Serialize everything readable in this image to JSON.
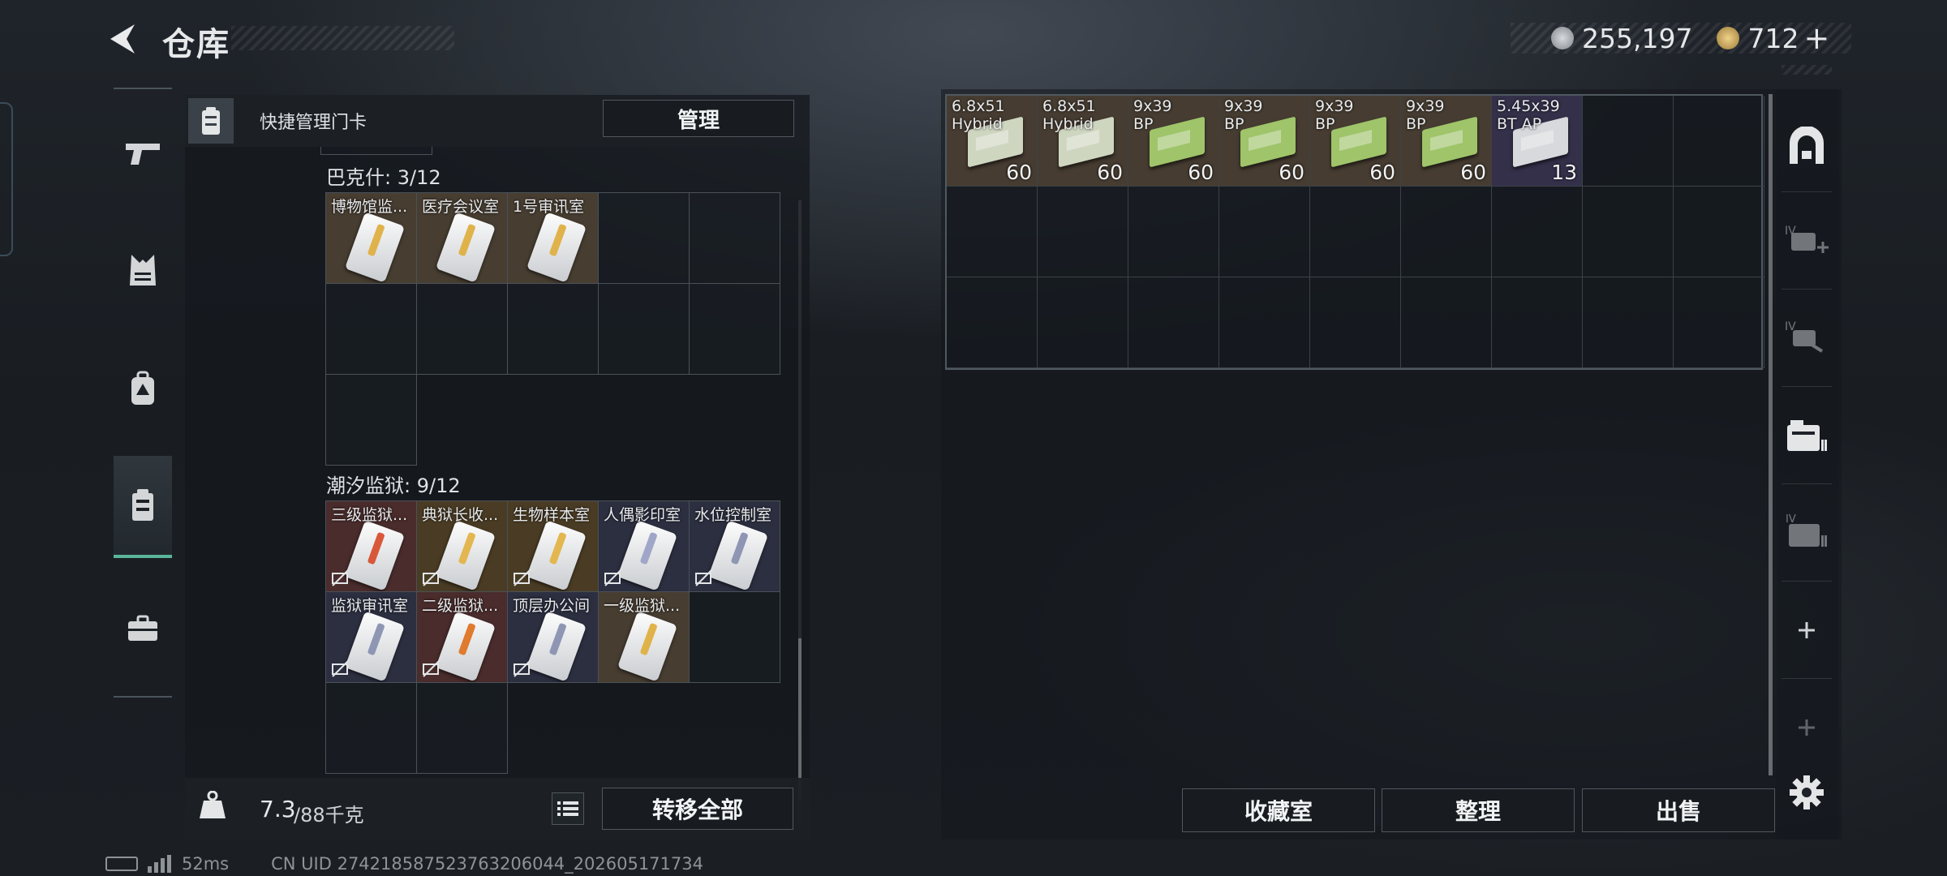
{
  "header": {
    "title": "仓库",
    "currency1": "255,197",
    "currency2": "712",
    "plus": "+"
  },
  "sidebar": {
    "items": [
      {
        "name": "weapons"
      },
      {
        "name": "armor"
      },
      {
        "name": "backpack"
      },
      {
        "name": "keycard-case",
        "active": true
      },
      {
        "name": "toolbox"
      }
    ]
  },
  "left_panel": {
    "header_label": "快捷管理门卡",
    "manage_button": "管理",
    "sections": [
      {
        "title": "巴克什: 3/12",
        "cards": [
          {
            "label": "博物馆监...",
            "tint": "#e0b24a",
            "locked": false
          },
          {
            "label": "医疗会议室",
            "tint": "#e0b24a",
            "locked": false
          },
          {
            "label": "1号审讯室",
            "tint": "#e0b24a",
            "locked": false
          }
        ]
      },
      {
        "title": "潮汐监狱: 9/12",
        "cards": [
          {
            "label": "三级监狱...",
            "tint": "#d9583a",
            "locked": true
          },
          {
            "label": "典狱长收...",
            "tint": "#e3b64f",
            "locked": true
          },
          {
            "label": "生物样本室",
            "tint": "#e3b64f",
            "locked": true
          },
          {
            "label": "人偶影印室",
            "tint": "#a0a6c8",
            "locked": true
          },
          {
            "label": "水位控制室",
            "tint": "#8e96b4",
            "locked": true
          },
          {
            "label": "监狱审讯室",
            "tint": "#8e96b4",
            "locked": true
          },
          {
            "label": "二级监狱...",
            "tint": "#e07a2e",
            "locked": true
          },
          {
            "label": "顶层办公间",
            "tint": "#8e96b4",
            "locked": true
          },
          {
            "label": "一级监狱...",
            "tint": "#e0b24a",
            "locked": false
          }
        ]
      }
    ],
    "weight_value": "7.3",
    "weight_capacity": "/88千克",
    "transfer_all_button": "转移全部"
  },
  "right_panel": {
    "items": [
      {
        "name": "6.8x51\nHybrid",
        "qty": "60",
        "color": "#cfd6c0"
      },
      {
        "name": "6.8x51\nHybrid",
        "qty": "60",
        "color": "#cfd6c0"
      },
      {
        "name": "9x39\nBP",
        "qty": "60",
        "color": "#9fc46a"
      },
      {
        "name": "9x39\nBP",
        "qty": "60",
        "color": "#9fc46a"
      },
      {
        "name": "9x39\nBP",
        "qty": "60",
        "color": "#9fc46a"
      },
      {
        "name": "9x39\nBP",
        "qty": "60",
        "color": "#9fc46a"
      },
      {
        "name": "5.45x39\nBT AP",
        "qty": "13",
        "color": "#d7d9dc"
      }
    ],
    "buttons": {
      "collection": "收藏室",
      "sort": "整理",
      "sell": "出售"
    }
  },
  "status_bar": {
    "ping": "52ms",
    "uid": "CN UID 274218587523763206044_202605171734"
  },
  "accent_color": "#5fc3a5"
}
